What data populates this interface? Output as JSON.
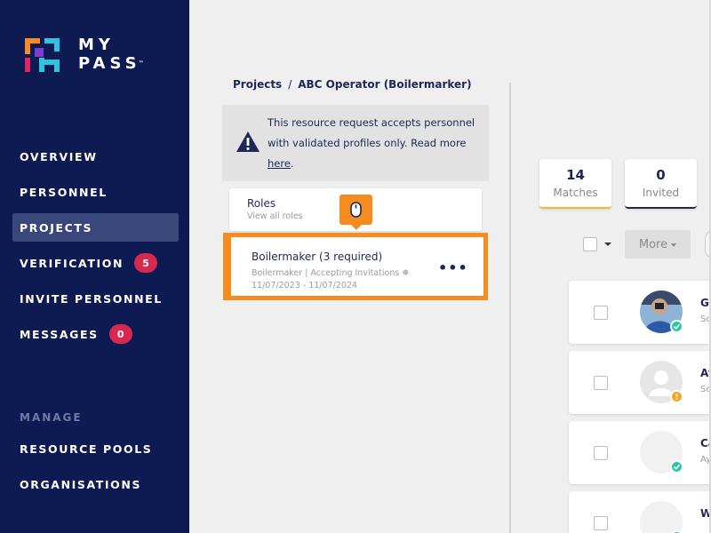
{
  "brand": {
    "line1": "MY",
    "line2": "PASS",
    "tm": "™"
  },
  "sidebar": {
    "items": [
      {
        "label": "OVERVIEW"
      },
      {
        "label": "PERSONNEL"
      },
      {
        "label": "PROJECTS",
        "active": true
      },
      {
        "label": "VERIFICATION",
        "badge": "5"
      },
      {
        "label": "INVITE PERSONNEL"
      },
      {
        "label": "MESSAGES",
        "badge": "0"
      }
    ],
    "section_label": "MANAGE",
    "manage_items": [
      {
        "label": "RESOURCE POOLS"
      },
      {
        "label": "ORGANISATIONS"
      }
    ]
  },
  "breadcrumb": {
    "parent": "Projects",
    "separator": "/",
    "current": "ABC Operator (Boilermarker)"
  },
  "notice": {
    "icon": "warning-icon",
    "text_before_link": "This resource request accepts personnel with validated profiles only. Read more",
    "link": "here",
    "text_after_link": "."
  },
  "roles_card": {
    "title": "Roles",
    "subtitle": "View all roles"
  },
  "tooltip": {
    "icon": "mouse-icon"
  },
  "selected_role": {
    "title": "Boilermaker (3 required)",
    "meta_line1": "Boilermaker | Accepting Invitations ❅",
    "meta_line2": "11/07/2023 - 11/07/2024",
    "menu_icon": "more-icon",
    "menu_glyph": "•••"
  },
  "stats": [
    {
      "value": "14",
      "label": "Matches"
    },
    {
      "value": "0",
      "label": "Invited"
    }
  ],
  "toolbar": {
    "more_label": "More"
  },
  "people": [
    {
      "name": "Ge",
      "sub": "So",
      "status": "verified"
    },
    {
      "name": "Ay",
      "sub": "So",
      "status": "warning"
    },
    {
      "name": "Ca",
      "sub": "Ay",
      "status": "verified"
    },
    {
      "name": "Wi",
      "sub": "",
      "status": "verified"
    }
  ],
  "colors": {
    "sidebar_bg": "#0d1b52",
    "accent_orange": "#f68b1f",
    "badge_red": "#d8284f",
    "navy_text": "#1e2757",
    "verified_green": "#2ec4a4",
    "warning_orange": "#f5a524"
  }
}
